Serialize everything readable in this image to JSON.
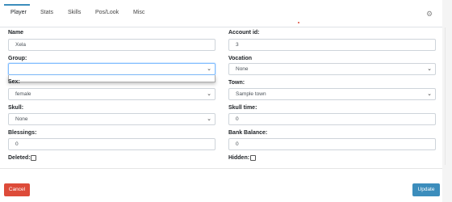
{
  "tabs": [
    {
      "label": "Player"
    },
    {
      "label": "Stats"
    },
    {
      "label": "Skills"
    },
    {
      "label": "Pos/Look"
    },
    {
      "label": "Misc"
    }
  ],
  "form": {
    "name": {
      "label": "Name",
      "value": "Xela"
    },
    "account_id": {
      "label": "Account id:",
      "value": "3"
    },
    "group": {
      "label": "Group:",
      "value": ""
    },
    "vocation": {
      "label": "Vocation",
      "value": "None"
    },
    "sex": {
      "label": "Sex:",
      "value": "female"
    },
    "town": {
      "label": "Town:",
      "value": "Sample town"
    },
    "skull": {
      "label": "Skull:",
      "value": "None"
    },
    "skull_time": {
      "label": "Skull time:",
      "value": "0"
    },
    "blessings": {
      "label": "Blessings:",
      "value": "0"
    },
    "bank_balance": {
      "label": "Bank Balance:",
      "value": "0"
    },
    "deleted": {
      "label": "Deleted:",
      "checked": false
    },
    "hidden": {
      "label": "Hidden:",
      "checked": false
    }
  },
  "buttons": {
    "cancel": "Cancel",
    "update": "Update"
  },
  "icons": {
    "settings": "gear-icon",
    "select": "chevron-down-icon"
  },
  "colors": {
    "primary": "#3c8dbc",
    "danger": "#dd4b39"
  }
}
